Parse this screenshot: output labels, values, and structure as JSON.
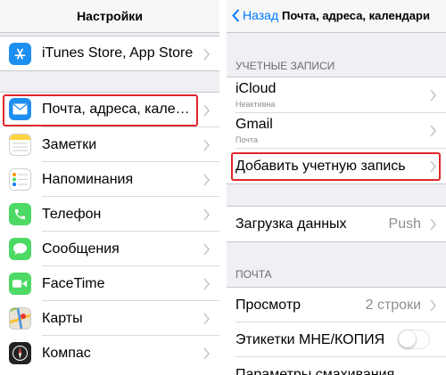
{
  "colors": {
    "accent": "#007aff",
    "highlight": "#e0262b",
    "app_store": "#1e8ff0",
    "mail": "#1f8ef1",
    "notes": "#ffd33f",
    "phone": "#4cd964",
    "messages": "#4cd964",
    "facetime": "#4cd964",
    "compass": "#222222"
  },
  "left": {
    "title": "Настройки",
    "items": [
      {
        "label": "iTunes Store, App Store",
        "icon": "app-store-icon"
      },
      {
        "label": "Почта, адреса, кале…",
        "icon": "mail-icon"
      },
      {
        "label": "Заметки",
        "icon": "notes-icon"
      },
      {
        "label": "Напоминания",
        "icon": "reminders-icon"
      },
      {
        "label": "Телефон",
        "icon": "phone-icon"
      },
      {
        "label": "Сообщения",
        "icon": "messages-icon"
      },
      {
        "label": "FaceTime",
        "icon": "facetime-icon"
      },
      {
        "label": "Карты",
        "icon": "maps-icon"
      },
      {
        "label": "Компас",
        "icon": "compass-icon"
      }
    ]
  },
  "right": {
    "back_label": "Назад",
    "title": "Почта, адреса, календари",
    "accounts_header": "УЧЕТНЫЕ ЗАПИСИ",
    "accounts": [
      {
        "name": "iCloud",
        "status": "Неактивна"
      },
      {
        "name": "Gmail",
        "status": "Почта"
      }
    ],
    "add_account": "Добавить учетную запись",
    "fetch": {
      "label": "Загрузка данных",
      "value": "Push"
    },
    "mail_header": "ПОЧТА",
    "preview": {
      "label": "Просмотр",
      "value": "2 строки"
    },
    "to_cc": {
      "label": "Этикетки МНЕ/КОПИЯ",
      "on": false
    },
    "swipe": {
      "label": "Параметры смахивания"
    }
  }
}
